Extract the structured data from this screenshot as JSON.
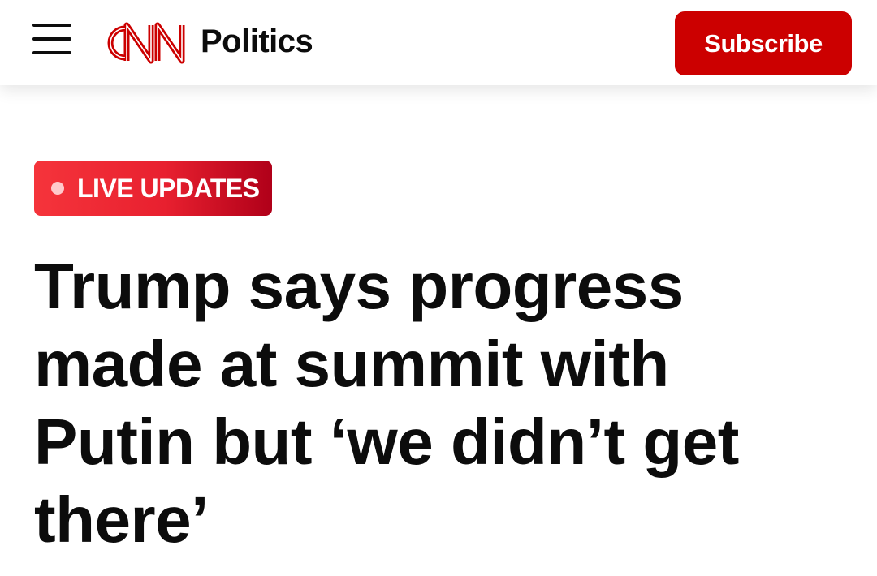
{
  "header": {
    "logo_text": "CNN",
    "section_name": "Politics",
    "subscribe_label": "Subscribe",
    "brand_color": "#cc0000"
  },
  "icons": {
    "menu": "hamburger-menu-icon",
    "logo": "cnn-logo"
  },
  "article": {
    "badge": {
      "label": "LIVE UPDATES",
      "color": "#e8202f"
    },
    "headline": "Trump says progress made at summit with Putin but ‘we didn’t get there’"
  }
}
